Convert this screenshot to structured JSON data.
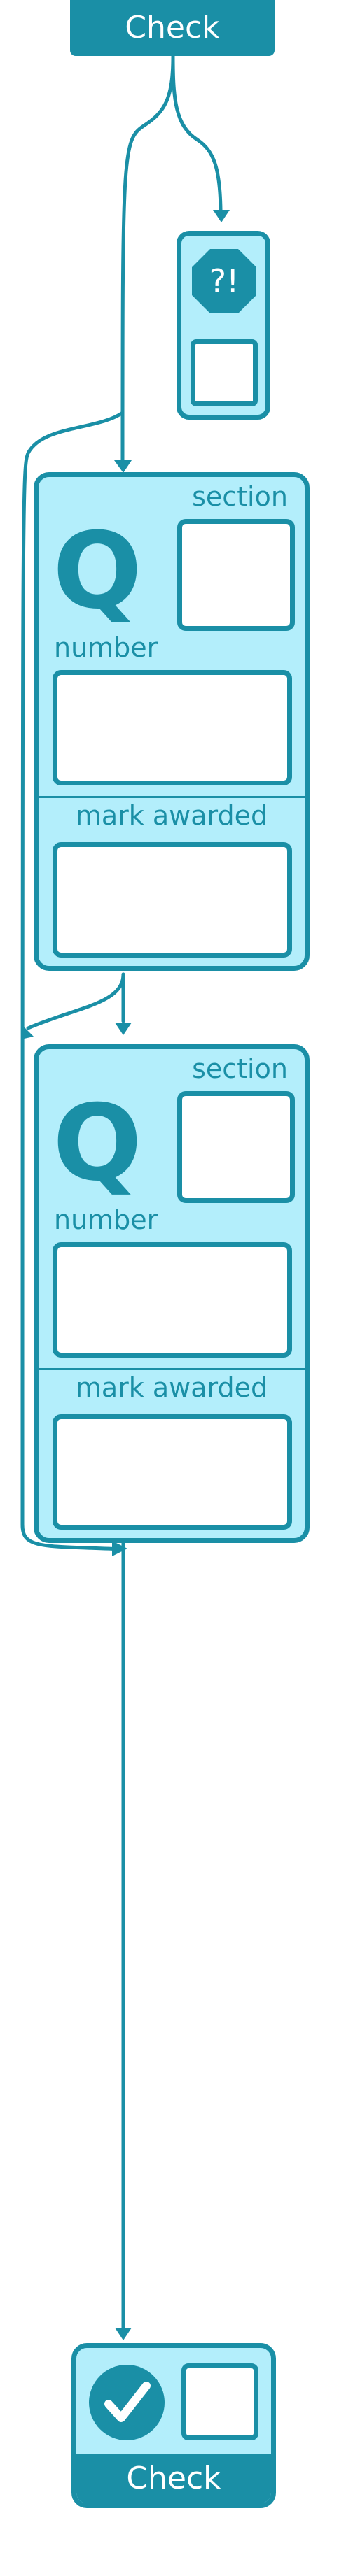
{
  "header": {
    "label": "Check"
  },
  "alert": {
    "symbol": "?!"
  },
  "question_cards": [
    {
      "glyph": "Q",
      "section_label": "section",
      "number_label": "number",
      "mark_label": "mark awarded"
    },
    {
      "glyph": "Q",
      "section_label": "section",
      "number_label": "number",
      "mark_label": "mark awarded"
    }
  ],
  "footer": {
    "label": "Check"
  },
  "colors": {
    "primary": "#1a8fa6",
    "panel": "#b3eefb",
    "box": "#ffffff"
  }
}
